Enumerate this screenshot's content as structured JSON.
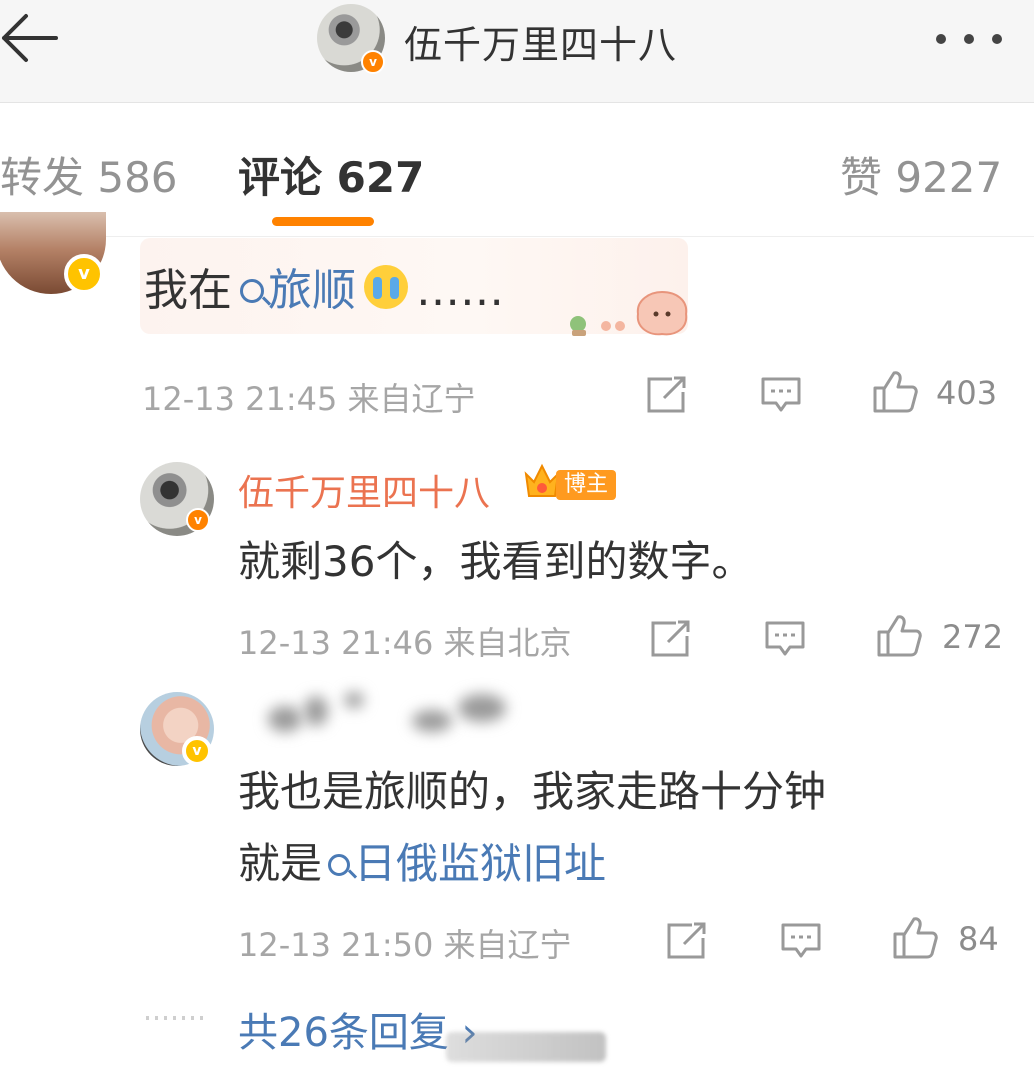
{
  "nav": {
    "title": "伍千万里四十八",
    "verified_badge": "v",
    "back_icon": "back-arrow-icon",
    "more_icon": "more-dots-icon"
  },
  "tabs": [
    {
      "label": "转发 586"
    },
    {
      "label": "评论 627"
    },
    {
      "label": "赞 9227"
    }
  ],
  "colors": {
    "accent": "#ff8200",
    "link": "#4a7ab5",
    "name_highlight": "#eb7350",
    "verified_yellow": "#ffc300"
  },
  "comment": {
    "text_prefix": "我在",
    "topic": "旅顺",
    "emoji": "crying-face",
    "text_suffix": "……",
    "time": "12-13 21:45",
    "location": "来自辽宁",
    "likes": "403",
    "verified_badge": "v"
  },
  "replies": [
    {
      "name": "伍千万里四十八",
      "badge": "博主",
      "lines": [
        "就剩36个，我看到的数字。"
      ],
      "time": "12-13 21:46",
      "location": "来自北京",
      "likes": "272"
    },
    {
      "name_blurred": true,
      "line1": "我也是旅顺的，我家走路十分钟",
      "line2_prefix": "就是",
      "line2_topic": "日俄监狱旧址",
      "time": "12-13 21:50",
      "location": "来自辽宁",
      "likes": "84"
    }
  ],
  "more_replies": "共26条回复 ›"
}
